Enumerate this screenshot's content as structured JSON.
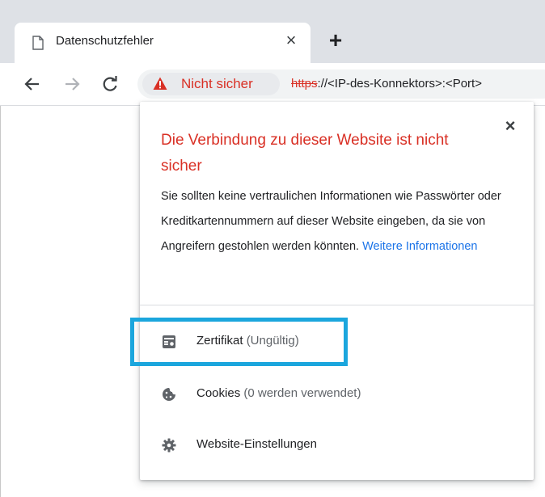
{
  "tab": {
    "title": "Datenschutzfehler",
    "close_icon": "×",
    "new_tab_icon": "+"
  },
  "omnibox": {
    "security_chip_label": "Nicht sicher",
    "url_scheme": "https",
    "url_rest": "://<IP-des-Konnektors>:<Port>"
  },
  "popup": {
    "close_icon": "×",
    "title": "Die Verbindung zu dieser Website ist nicht sicher",
    "body": "Sie sollten keine vertraulichen Informationen wie Passwörter oder Kreditkartennummern auf dieser Website eingeben, da sie von Angreifern gestohlen werden könnten.",
    "more_info_link": "Weitere Informationen",
    "items": [
      {
        "label": "Zertifikat",
        "sub": "(Ungültig)",
        "icon": "certificate-icon"
      },
      {
        "label": "Cookies",
        "sub": "(0 werden verwendet)",
        "icon": "cookie-icon"
      },
      {
        "label": "Website-Einstellungen",
        "sub": "",
        "icon": "gear-icon"
      }
    ]
  },
  "colors": {
    "danger": "#d93025",
    "link": "#1a73e8",
    "highlight": "#1ba6dd"
  }
}
